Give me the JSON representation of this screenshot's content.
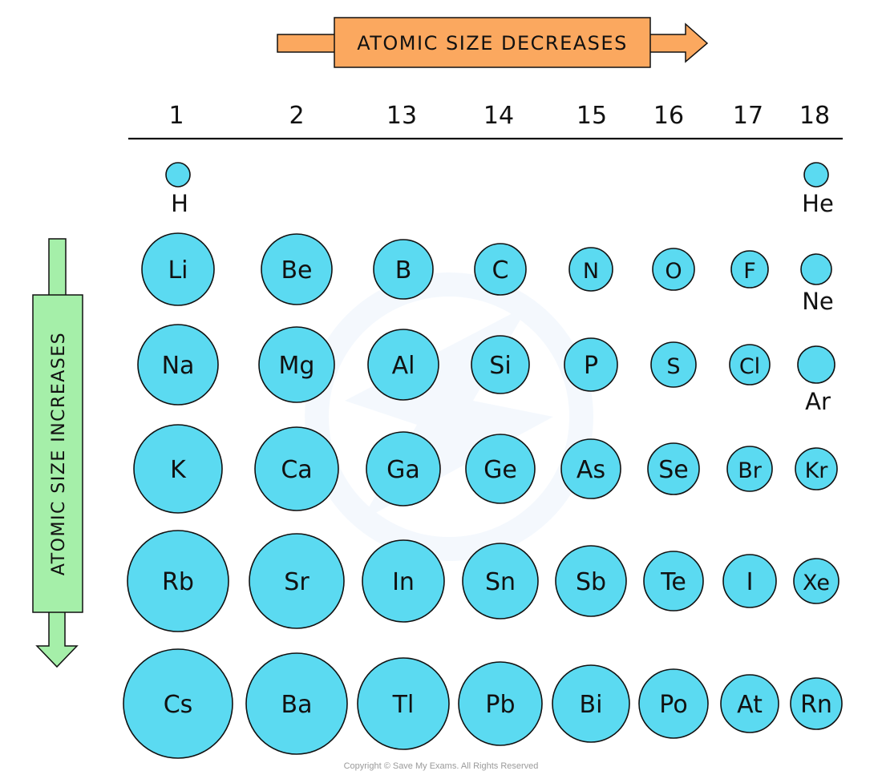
{
  "top_arrow": {
    "label": "ATOMIC SIZE DECREASES",
    "color": "#FBA85F"
  },
  "side_arrow": {
    "label": "ATOMIC SIZE INCREASES",
    "color": "#A5EFA9"
  },
  "atom_color": "#5BDAF1",
  "groups": [
    "1",
    "2",
    "13",
    "14",
    "15",
    "16",
    "17",
    "18"
  ],
  "rows": [
    [
      {
        "symbol": "H",
        "group": "1",
        "label_below": true
      },
      {
        "symbol": "He",
        "group": "18",
        "label_below": true
      }
    ],
    [
      {
        "symbol": "Li",
        "group": "1"
      },
      {
        "symbol": "Be",
        "group": "2"
      },
      {
        "symbol": "B",
        "group": "13"
      },
      {
        "symbol": "C",
        "group": "14"
      },
      {
        "symbol": "N",
        "group": "15"
      },
      {
        "symbol": "O",
        "group": "16"
      },
      {
        "symbol": "F",
        "group": "17"
      },
      {
        "symbol": "Ne",
        "group": "18",
        "label_below": true
      }
    ],
    [
      {
        "symbol": "Na",
        "group": "1"
      },
      {
        "symbol": "Mg",
        "group": "2"
      },
      {
        "symbol": "Al",
        "group": "13"
      },
      {
        "symbol": "Si",
        "group": "14"
      },
      {
        "symbol": "P",
        "group": "15"
      },
      {
        "symbol": "S",
        "group": "16"
      },
      {
        "symbol": "Cl",
        "group": "17"
      },
      {
        "symbol": "Ar",
        "group": "18",
        "label_below": true
      }
    ],
    [
      {
        "symbol": "K",
        "group": "1"
      },
      {
        "symbol": "Ca",
        "group": "2"
      },
      {
        "symbol": "Ga",
        "group": "13"
      },
      {
        "symbol": "Ge",
        "group": "14"
      },
      {
        "symbol": "As",
        "group": "15"
      },
      {
        "symbol": "Se",
        "group": "16"
      },
      {
        "symbol": "Br",
        "group": "17"
      },
      {
        "symbol": "Kr",
        "group": "18"
      }
    ],
    [
      {
        "symbol": "Rb",
        "group": "1"
      },
      {
        "symbol": "Sr",
        "group": "2"
      },
      {
        "symbol": "In",
        "group": "13"
      },
      {
        "symbol": "Sn",
        "group": "14"
      },
      {
        "symbol": "Sb",
        "group": "15"
      },
      {
        "symbol": "Te",
        "group": "16"
      },
      {
        "symbol": "I",
        "group": "17"
      },
      {
        "symbol": "Xe",
        "group": "18"
      }
    ],
    [
      {
        "symbol": "Cs",
        "group": "1"
      },
      {
        "symbol": "Ba",
        "group": "2"
      },
      {
        "symbol": "Tl",
        "group": "13"
      },
      {
        "symbol": "Pb",
        "group": "14"
      },
      {
        "symbol": "Bi",
        "group": "15"
      },
      {
        "symbol": "Po",
        "group": "16"
      },
      {
        "symbol": "At",
        "group": "17"
      },
      {
        "symbol": "Rn",
        "group": "18"
      }
    ]
  ],
  "copyright": "Copyright © Save My Exams. All Rights Reserved"
}
